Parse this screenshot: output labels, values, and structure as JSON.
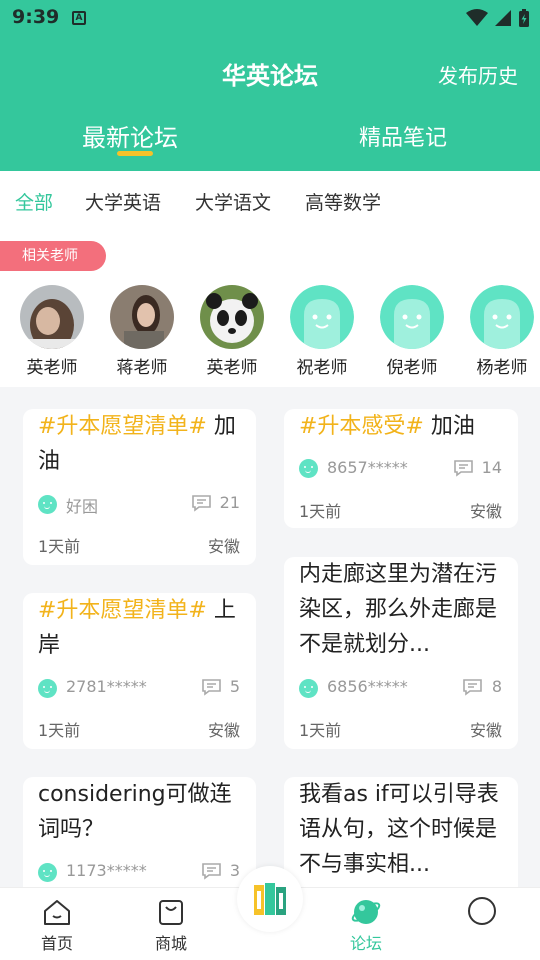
{
  "status": {
    "time": "9:39",
    "a_icon": "A"
  },
  "header": {
    "title": "华英论坛",
    "publish_history": "发布历史",
    "tabs": [
      {
        "label": "最新论坛",
        "active": true
      },
      {
        "label": "精品笔记",
        "active": false
      }
    ]
  },
  "categories": [
    {
      "label": "全部",
      "active": true
    },
    {
      "label": "大学英语",
      "active": false
    },
    {
      "label": "大学语文",
      "active": false
    },
    {
      "label": "高等数学",
      "active": false
    }
  ],
  "teachers": {
    "label": "相关老师",
    "items": [
      {
        "name": "英老师"
      },
      {
        "name": "蒋老师"
      },
      {
        "name": "英老师"
      },
      {
        "name": "祝老师"
      },
      {
        "name": "倪老师"
      },
      {
        "name": "杨老师"
      }
    ]
  },
  "posts": [
    {
      "tag": "#升本愿望清单#",
      "text": " 加油",
      "user": "好困",
      "comments": "21",
      "time": "1天前",
      "location": "安徽"
    },
    {
      "tag": "#升本感受#",
      "text": " 加油",
      "user": "8657*****",
      "comments": "14",
      "time": "1天前",
      "location": "安徽"
    },
    {
      "tag": "#升本愿望清单#",
      "text": " 上岸",
      "user": "2781*****",
      "comments": "5",
      "time": "1天前",
      "location": "安徽"
    },
    {
      "tag": "",
      "text": "内走廊这里为潜在污染区，那么外走廊是不是就划分...",
      "user": "6856*****",
      "comments": "8",
      "time": "1天前",
      "location": "安徽"
    },
    {
      "tag": "",
      "text": "considering可做连词吗？",
      "user": "1173*****",
      "comments": "3",
      "time": "",
      "location": ""
    },
    {
      "tag": "",
      "text": "我看as if可以引导表语从句，这个时候是不与事实相...",
      "user": "",
      "comments": "",
      "time": "",
      "location": ""
    }
  ],
  "nav": {
    "items": [
      {
        "label": "首页",
        "icon": "home-icon"
      },
      {
        "label": "商城",
        "icon": "shopping-bag-icon"
      },
      {
        "label": "",
        "icon": "center-logo-icon"
      },
      {
        "label": "论坛",
        "icon": "forum-planet-icon",
        "active": true
      },
      {
        "label": "",
        "icon": "profile-icon"
      }
    ]
  },
  "colors": {
    "primary": "#34c79c",
    "accent": "#f6c229",
    "tag": "#f2b31b",
    "teacher_pill": "#f36f7c"
  }
}
